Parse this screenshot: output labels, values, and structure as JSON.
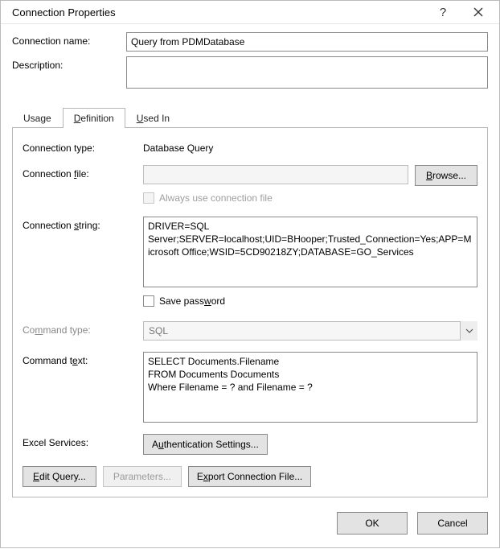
{
  "title": "Connection Properties",
  "header": {
    "name_label": "Connection name:",
    "name_value": "Query from PDMDatabase",
    "desc_label": "Description:",
    "desc_value": ""
  },
  "tabs": {
    "usage": "Usage",
    "definition": "Definition",
    "usedin": "Used In"
  },
  "panel": {
    "conn_type_label": "Connection type:",
    "conn_type_value": "Database Query",
    "conn_file_label": "Connection file:",
    "conn_file_value": "",
    "browse_label": "Browse...",
    "always_use_label": "Always use connection file",
    "conn_string_label": "Connection string:",
    "conn_string_value": "DRIVER=SQL Server;SERVER=localhost;UID=BHooper;Trusted_Connection=Yes;APP=Microsoft Office;WSID=5CD90218ZY;DATABASE=GO_Services",
    "save_pw_label": "Save password",
    "cmd_type_label": "Command type:",
    "cmd_type_value": "SQL",
    "cmd_text_label": "Command text:",
    "cmd_text_value": "SELECT Documents.Filename\nFROM Documents Documents\nWhere Filename = ? and Filename = ?",
    "excel_svc_label": "Excel Services:",
    "auth_btn_label": "Authentication Settings...",
    "edit_query_label": "Edit Query...",
    "parameters_label": "Parameters...",
    "export_label": "Export Connection File..."
  },
  "footer": {
    "ok": "OK",
    "cancel": "Cancel"
  }
}
